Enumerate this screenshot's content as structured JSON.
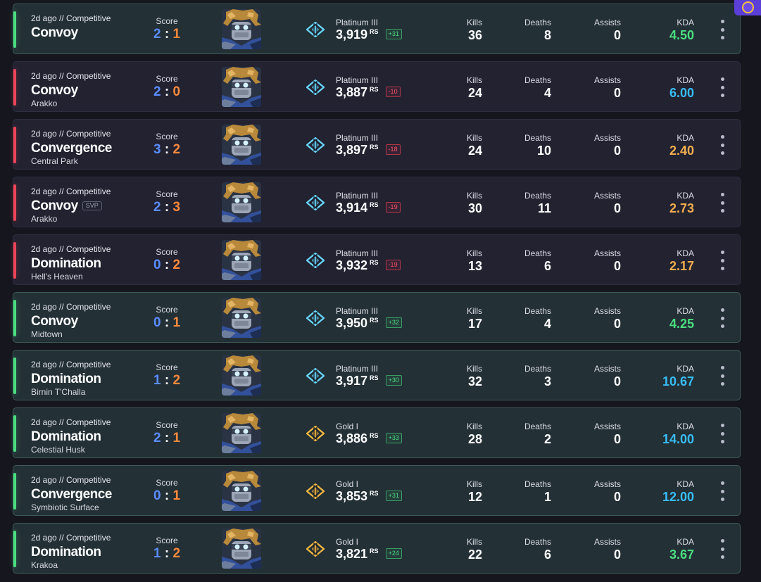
{
  "colors": {
    "win": "#4ade80",
    "loss": "#ef4458",
    "score_self": "#5b8cff",
    "score_enemy": "#ff8a3d",
    "kda_green": "#4ade80",
    "kda_blue": "#38bdf8",
    "kda_orange": "#f0ad4e",
    "platinum": "#6ad8ff",
    "gold": "#f5b942"
  },
  "labels": {
    "score": "Score",
    "kills": "Kills",
    "deaths": "Deaths",
    "assists": "Assists",
    "kda": "KDA",
    "rs": "RS"
  },
  "matches": [
    {
      "result": "win",
      "meta": "2d ago // Competitive",
      "map": "Convoy",
      "sub": "",
      "svp": "",
      "score_a": "2",
      "score_sep": ":",
      "score_b": "1",
      "rank": "Platinum III",
      "rank_tier": "platinum",
      "rank_value": "3,919",
      "delta": "+31",
      "kills": "36",
      "deaths": "8",
      "assists": "0",
      "kda": "4.50",
      "kda_color": "green"
    },
    {
      "result": "loss",
      "meta": "2d ago // Competitive",
      "map": "Convoy",
      "sub": "Arakko",
      "svp": "",
      "score_a": "2",
      "score_sep": ":",
      "score_b": "0",
      "rank": "Platinum III",
      "rank_tier": "platinum",
      "rank_value": "3,887",
      "delta": "-10",
      "kills": "24",
      "deaths": "4",
      "assists": "0",
      "kda": "6.00",
      "kda_color": "blue"
    },
    {
      "result": "loss",
      "meta": "2d ago // Competitive",
      "map": "Convergence",
      "sub": "Central Park",
      "svp": "",
      "score_a": "3",
      "score_sep": ":",
      "score_b": "2",
      "rank": "Platinum III",
      "rank_tier": "platinum",
      "rank_value": "3,897",
      "delta": "-18",
      "kills": "24",
      "deaths": "10",
      "assists": "0",
      "kda": "2.40",
      "kda_color": "orange"
    },
    {
      "result": "loss",
      "meta": "2d ago // Competitive",
      "map": "Convoy",
      "sub": "Arakko",
      "svp": "SVP",
      "score_a": "2",
      "score_sep": ":",
      "score_b": "3",
      "rank": "Platinum III",
      "rank_tier": "platinum",
      "rank_value": "3,914",
      "delta": "-19",
      "kills": "30",
      "deaths": "11",
      "assists": "0",
      "kda": "2.73",
      "kda_color": "orange"
    },
    {
      "result": "loss",
      "meta": "2d ago // Competitive",
      "map": "Domination",
      "sub": "Hell's Heaven",
      "svp": "",
      "score_a": "0",
      "score_sep": ":",
      "score_b": "2",
      "rank": "Platinum III",
      "rank_tier": "platinum",
      "rank_value": "3,932",
      "delta": "-19",
      "kills": "13",
      "deaths": "6",
      "assists": "0",
      "kda": "2.17",
      "kda_color": "orange"
    },
    {
      "result": "win",
      "meta": "2d ago // Competitive",
      "map": "Convoy",
      "sub": "Midtown",
      "svp": "",
      "score_a": "0",
      "score_sep": ":",
      "score_b": "1",
      "rank": "Platinum III",
      "rank_tier": "platinum",
      "rank_value": "3,950",
      "delta": "+32",
      "kills": "17",
      "deaths": "4",
      "assists": "0",
      "kda": "4.25",
      "kda_color": "green"
    },
    {
      "result": "win",
      "meta": "2d ago // Competitive",
      "map": "Domination",
      "sub": "Birnin T'Challa",
      "svp": "",
      "score_a": "1",
      "score_sep": ":",
      "score_b": "2",
      "rank": "Platinum III",
      "rank_tier": "platinum",
      "rank_value": "3,917",
      "delta": "+30",
      "kills": "32",
      "deaths": "3",
      "assists": "0",
      "kda": "10.67",
      "kda_color": "blue"
    },
    {
      "result": "win",
      "meta": "2d ago // Competitive",
      "map": "Domination",
      "sub": "Celestial Husk",
      "svp": "",
      "score_a": "2",
      "score_sep": ":",
      "score_b": "1",
      "rank": "Gold I",
      "rank_tier": "gold",
      "rank_value": "3,886",
      "delta": "+33",
      "kills": "28",
      "deaths": "2",
      "assists": "0",
      "kda": "14.00",
      "kda_color": "blue"
    },
    {
      "result": "win",
      "meta": "2d ago // Competitive",
      "map": "Convergence",
      "sub": "Symbiotic Surface",
      "svp": "",
      "score_a": "0",
      "score_sep": ":",
      "score_b": "1",
      "rank": "Gold I",
      "rank_tier": "gold",
      "rank_value": "3,853",
      "delta": "+31",
      "kills": "12",
      "deaths": "1",
      "assists": "0",
      "kda": "12.00",
      "kda_color": "blue"
    },
    {
      "result": "win",
      "meta": "2d ago // Competitive",
      "map": "Domination",
      "sub": "Krakoa",
      "svp": "",
      "score_a": "1",
      "score_sep": ":",
      "score_b": "2",
      "rank": "Gold I",
      "rank_tier": "gold",
      "rank_value": "3,821",
      "delta": "+24",
      "kills": "22",
      "deaths": "6",
      "assists": "0",
      "kda": "3.67",
      "kda_color": "green"
    }
  ]
}
